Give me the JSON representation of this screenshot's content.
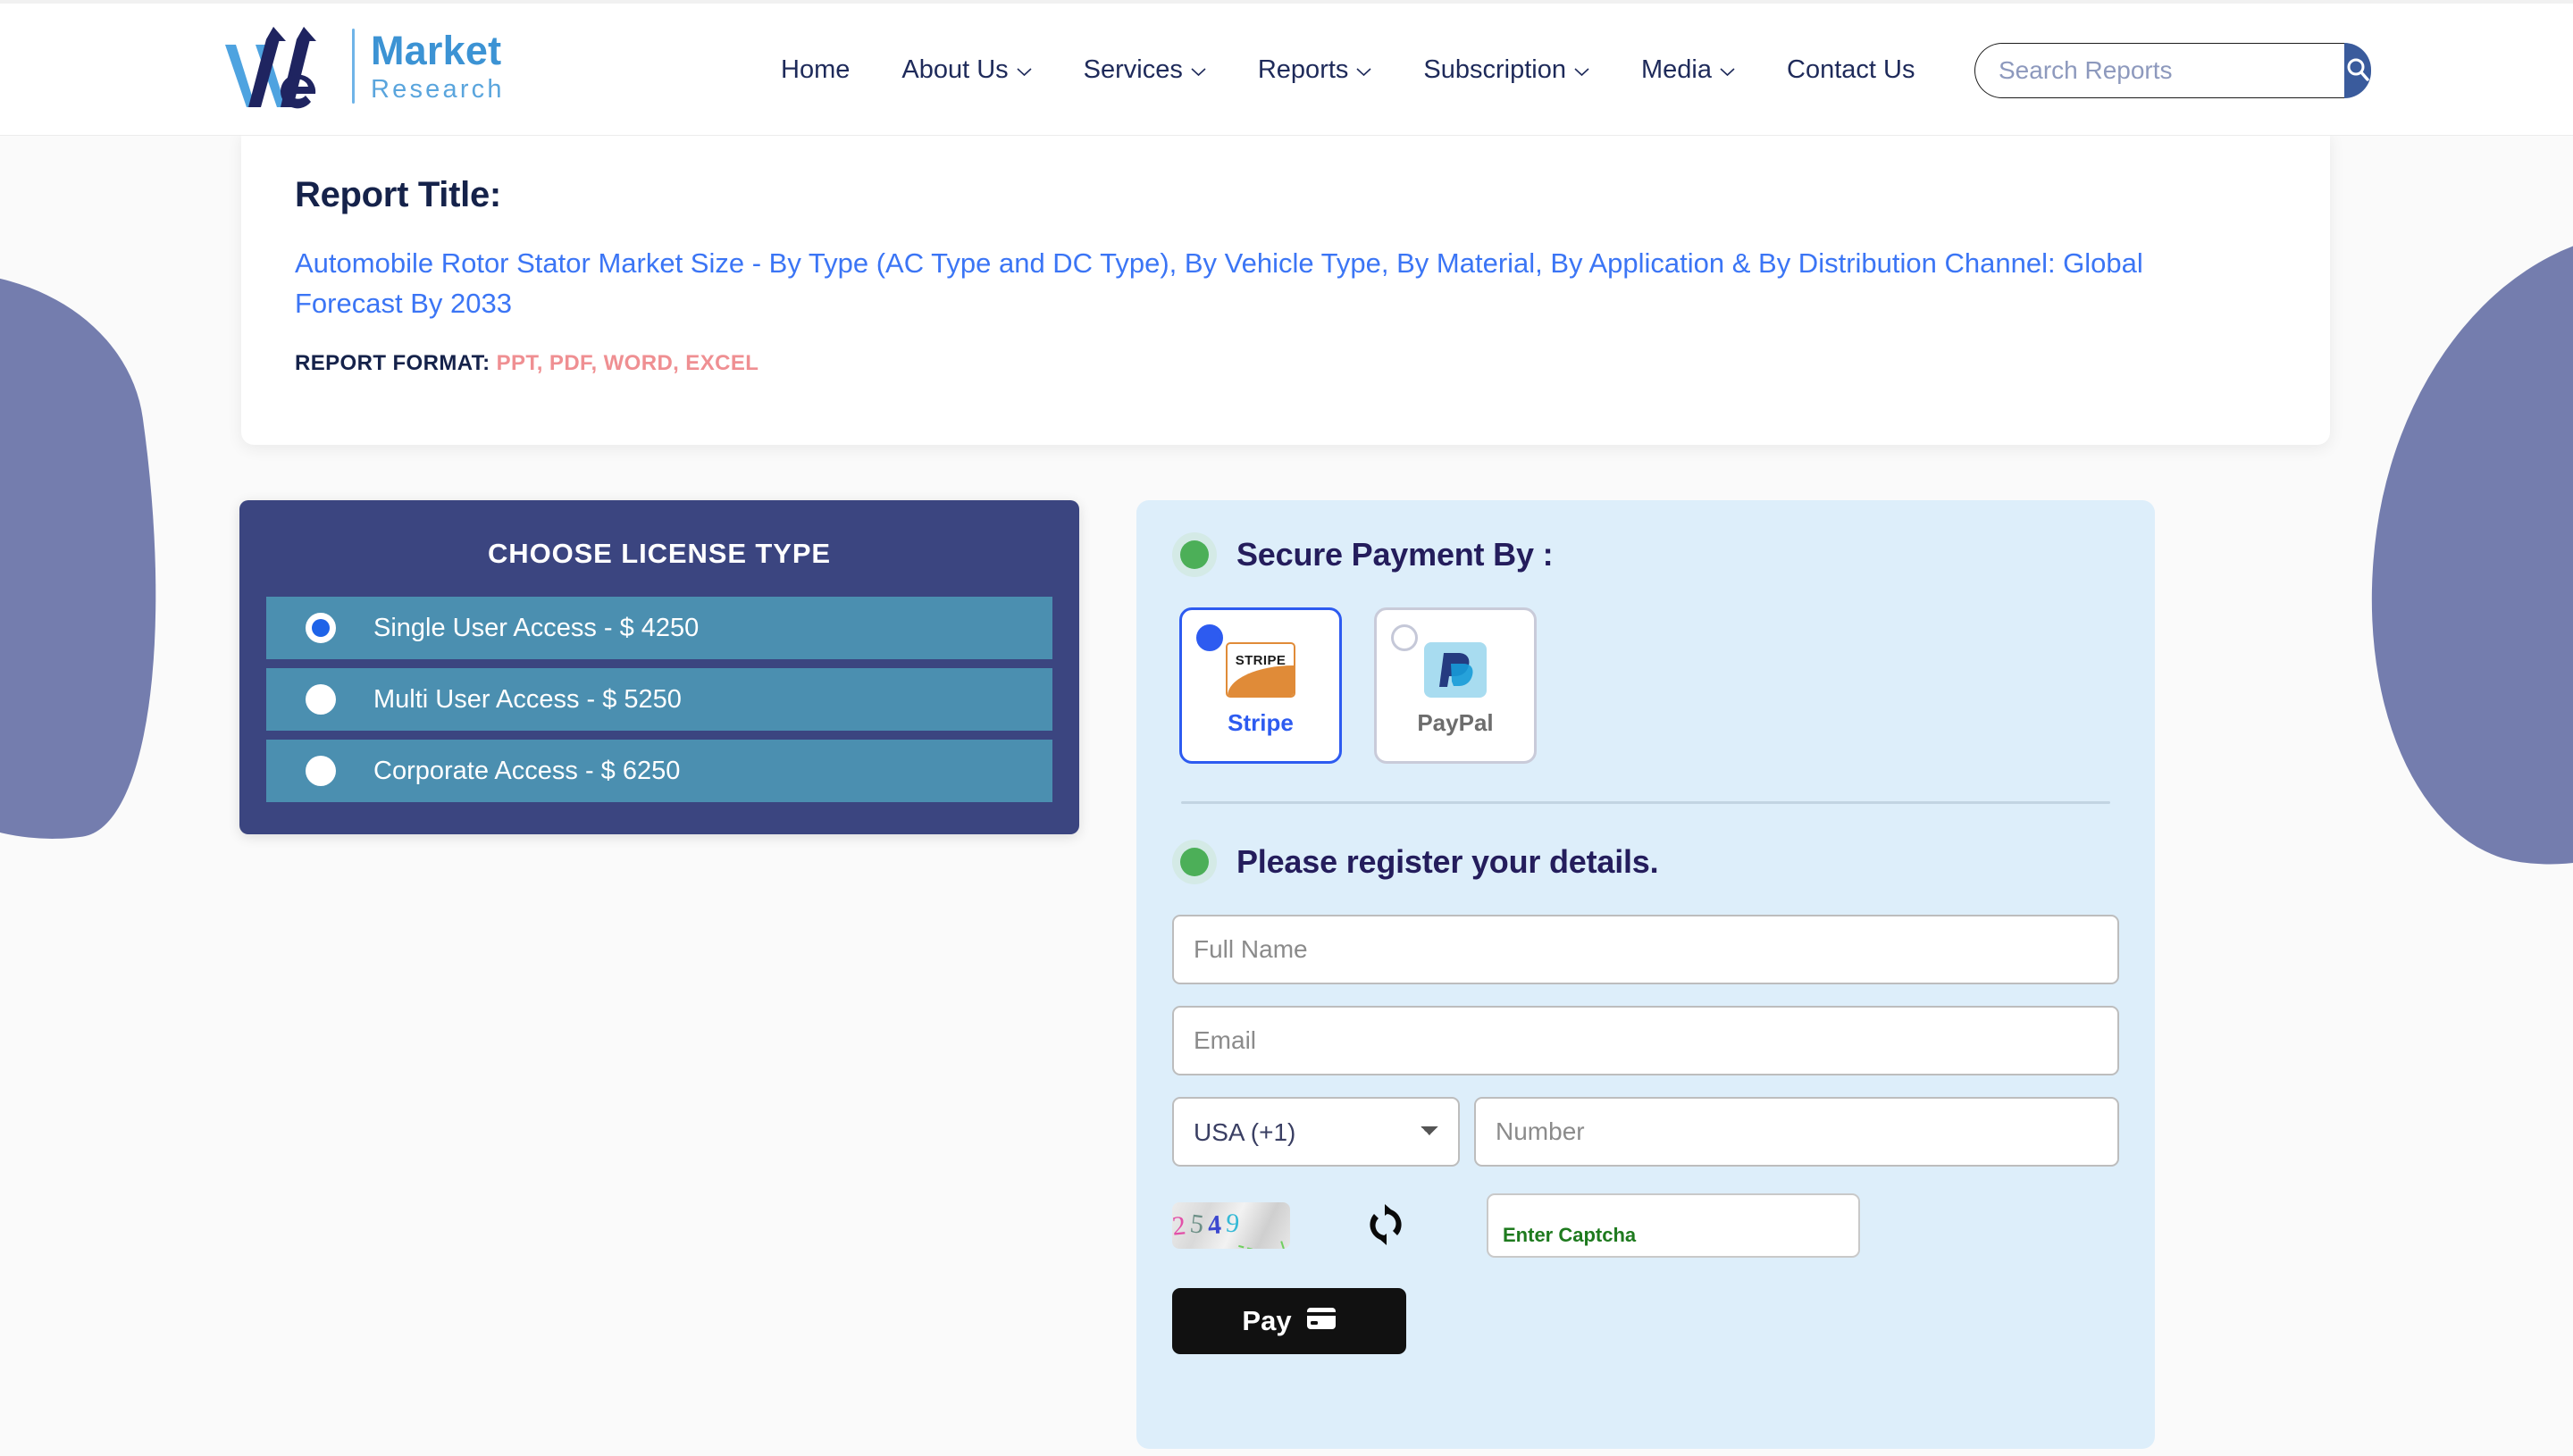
{
  "brand": {
    "name_line1": "Market",
    "name_line2": "Research",
    "logo_icon": "we-arrows-logo"
  },
  "nav": {
    "items": [
      {
        "label": "Home",
        "has_caret": false
      },
      {
        "label": "About Us",
        "has_caret": true
      },
      {
        "label": "Services",
        "has_caret": true
      },
      {
        "label": "Reports",
        "has_caret": true
      },
      {
        "label": "Subscription",
        "has_caret": true
      },
      {
        "label": "Media",
        "has_caret": true
      },
      {
        "label": "Contact Us",
        "has_caret": false
      }
    ]
  },
  "search": {
    "placeholder": "Search Reports",
    "value": "",
    "button_icon": "search-icon"
  },
  "report": {
    "heading": "Report Title:",
    "title": "Automobile Rotor Stator Market Size - By Type (AC Type and DC Type), By Vehicle Type, By Material, By Application & By Distribution Channel: Global Forecast By 2033",
    "format_label": "REPORT FORMAT:",
    "format_value": "PPT, PDF, WORD, EXCEL"
  },
  "license": {
    "title": "CHOOSE LICENSE TYPE",
    "options": [
      {
        "label": "Single User Access - $ 4250",
        "selected": true
      },
      {
        "label": "Multi User Access - $ 5250",
        "selected": false
      },
      {
        "label": "Corporate Access - $ 6250",
        "selected": false
      }
    ]
  },
  "payment": {
    "section_title": "Secure Payment By :",
    "methods": [
      {
        "name": "Stripe",
        "logo_text": "STRIPE",
        "selected": true
      },
      {
        "name": "PayPal",
        "logo_text": "P",
        "selected": false
      }
    ]
  },
  "register": {
    "section_title": "Please register your details.",
    "full_name": {
      "placeholder": "Full Name",
      "value": ""
    },
    "email": {
      "placeholder": "Email",
      "value": ""
    },
    "country_code": {
      "selected": "USA (+1)",
      "options": [
        "USA (+1)"
      ]
    },
    "phone": {
      "placeholder": "Number",
      "value": ""
    },
    "captcha": {
      "code": "2549",
      "digits": [
        "2",
        "5",
        "4",
        "9"
      ],
      "refresh_icon": "refresh-icon",
      "input_placeholder": "Enter Captcha",
      "input_value": ""
    },
    "pay_button": {
      "label": "Pay",
      "icon": "credit-card-icon"
    }
  },
  "colors": {
    "brand_navy": "#3b4580",
    "accent_blue": "#3b75f5",
    "license_row": "#4b8fb0",
    "panel_bg": "#ddeefa",
    "format_red": "#ef8f92",
    "green_dot": "#4caf58",
    "blob": "#747dae"
  }
}
